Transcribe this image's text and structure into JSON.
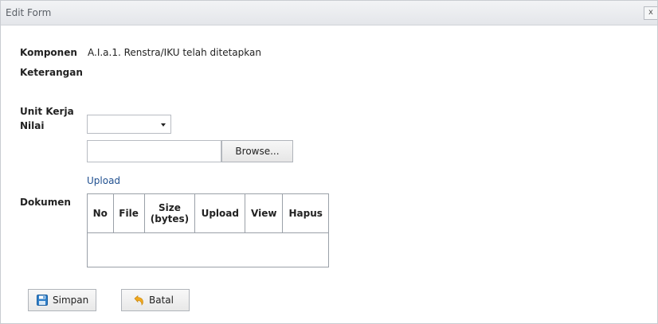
{
  "window": {
    "title": "Edit Form",
    "close_label": "x"
  },
  "form": {
    "komponen_label": "Komponen",
    "komponen_value": "A.I.a.1. Renstra/IKU telah ditetapkan",
    "keterangan_label": "Keterangan",
    "unit_kerja_label": "Unit Kerja",
    "nilai_label": "Nilai",
    "nilai_value": "",
    "file_value": "",
    "browse_label": "Browse...",
    "upload_link": "Upload",
    "dokumen_label": "Dokumen"
  },
  "table": {
    "columns": [
      "No",
      "File",
      "Size\n(bytes)",
      "Upload",
      "View",
      "Hapus"
    ],
    "rows": []
  },
  "buttons": {
    "save_label": "Simpan",
    "cancel_label": "Batal"
  },
  "icons": {
    "save": "floppy-disk-icon",
    "cancel": "undo-arrow-icon"
  },
  "colors": {
    "link": "#1f4f8f",
    "save_icon": "#2f7fc9",
    "cancel_icon": "#f0a81e"
  }
}
